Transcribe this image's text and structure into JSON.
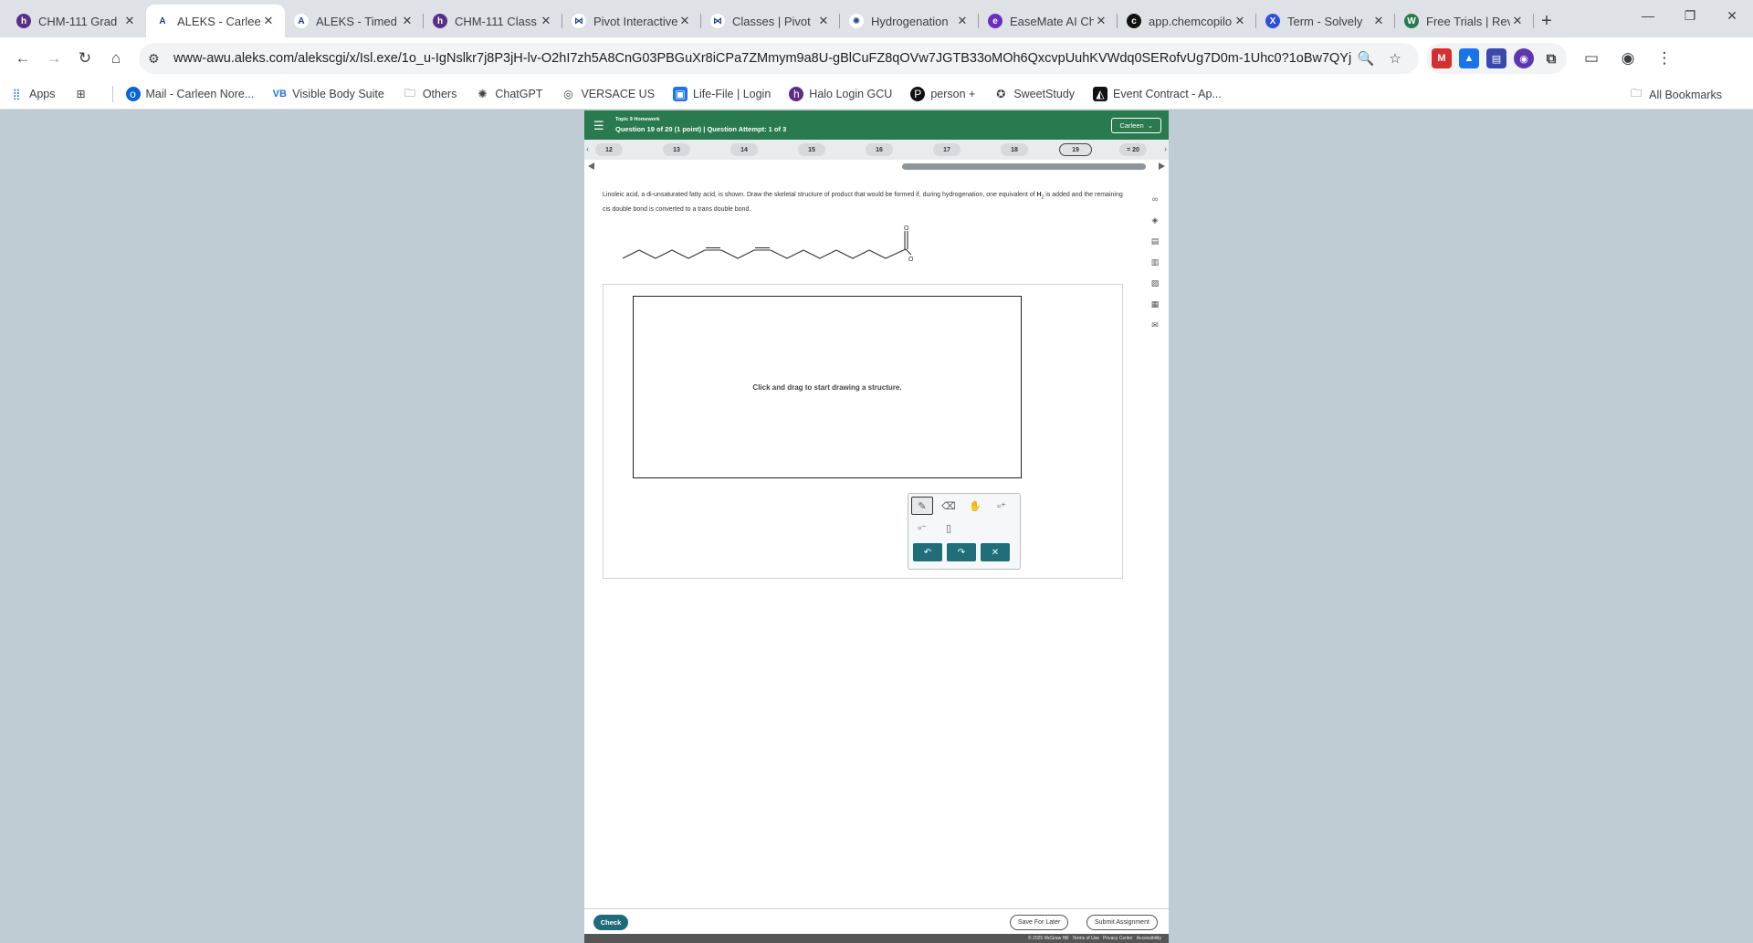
{
  "tabs": [
    {
      "title": "CHM-111 Grad",
      "fav_color": "#5b2d86",
      "fav_glyph": "h"
    },
    {
      "title": "ALEKS - Carleen",
      "fav_color": "#ffffff",
      "fav_glyph": "A",
      "active": true
    },
    {
      "title": "ALEKS - Timed",
      "fav_color": "#ffffff",
      "fav_glyph": "A"
    },
    {
      "title": "CHM-111 Class",
      "fav_color": "#5b2d86",
      "fav_glyph": "h"
    },
    {
      "title": "Pivot Interactive",
      "fav_color": "#ffffff",
      "fav_glyph": "⋈"
    },
    {
      "title": "Classes | Pivot",
      "fav_color": "#ffffff",
      "fav_glyph": "⋈"
    },
    {
      "title": "Hydrogenation",
      "fav_color": "#ffffff",
      "fav_glyph": "✺"
    },
    {
      "title": "EaseMate AI Ch",
      "fav_color": "#6b2fc0",
      "fav_glyph": "e"
    },
    {
      "title": "app.chemcopilo",
      "fav_color": "#111111",
      "fav_glyph": "c"
    },
    {
      "title": "Term - Solvely",
      "fav_color": "#2f4fdc",
      "fav_glyph": "X"
    },
    {
      "title": "Free Trials | Rev",
      "fav_color": "#2a7a4f",
      "fav_glyph": "W"
    }
  ],
  "toolbar": {
    "url": "www-awu.aleks.com/alekscgi/x/Isl.exe/1o_u-IgNslkr7j8P3jH-lv-O2hI7zh5A8CnG03PBGuXr8iCPa7ZMmym9a8U-gBlCuFZ8qOVw7JGTB33oMOh6QxcvpUuhKVWdq0SERofvUg7D0m-1Uhc0?1oBw7QYjlbavbSPXtx-YCjs..."
  },
  "bookmarks": {
    "items": [
      "Apps",
      "Mail - Carleen Nore...",
      "Visible Body Suite",
      "Others",
      "ChatGPT",
      "VERSACE US",
      "Life-File | Login",
      "Halo Login GCU",
      "person +",
      "SweetStudy",
      "Event Contract - Ap..."
    ],
    "all": "All Bookmarks"
  },
  "aleks": {
    "topic": "Topic 9 Homework",
    "question_info": "Question 19 of 20 (1 point)  |  Question Attempt: 1 of 3",
    "user": "Carleen",
    "question_numbers": [
      "12",
      "13",
      "14",
      "15",
      "16",
      "17",
      "18",
      "19",
      "= 20"
    ],
    "current_question": "19",
    "question_text_1": "Linoleic acid, a di-unsaturated fatty acid, is shown. Draw the skeletal structure of product that would be formed if, during hydrogenation, one equivalent of ",
    "h2_base": "H",
    "h2_sub": "2",
    "question_text_2": " is added and the remaining cis double bond is converted to a trans double bond.",
    "oh_label": "OH",
    "o_label": "O",
    "canvas_hint": "Click and drag to start drawing a structure.",
    "check": "Check",
    "save_later": "Save For Later",
    "submit": "Submit Assignment",
    "copyright": "© 2025 McGraw Hill",
    "terms": "Terms of Use",
    "privacy": "Privacy Center",
    "accessibility": "Accessibility"
  }
}
